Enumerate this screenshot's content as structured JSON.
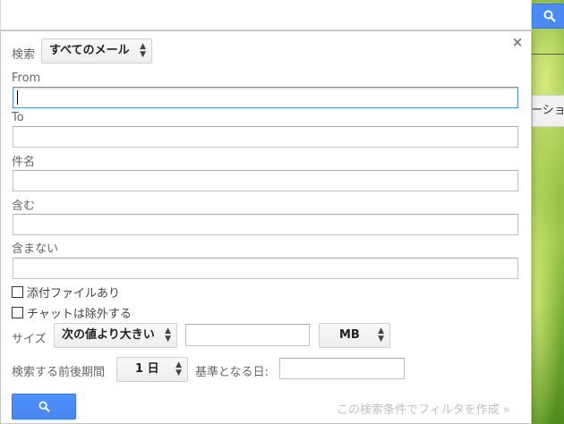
{
  "search_bar": {
    "value": "",
    "button_icon": "search-icon"
  },
  "side_tab": {
    "label": "ーション"
  },
  "panel": {
    "close_label": "×",
    "scope_label": "検索",
    "scope_value": "すべてのメール",
    "from_label": "From",
    "from_value": "",
    "to_label": "To",
    "to_value": "",
    "subject_label": "件名",
    "subject_value": "",
    "has_words_label": "含む",
    "has_words_value": "",
    "doesnt_have_label": "含まない",
    "doesnt_have_value": "",
    "has_attachment_label": "添付ファイルあり",
    "has_attachment_checked": false,
    "exclude_chats_label": "チャットは除外する",
    "exclude_chats_checked": false,
    "size_label": "サイズ",
    "size_operator": "次の値より大きい",
    "size_value": "",
    "size_unit": "MB",
    "date_within_label": "検索する前後期間",
    "date_within_value": "1 日",
    "date_base_label": "基準となる日:",
    "date_base_value": "",
    "search_button_icon": "search-icon",
    "create_filter_label": "この検索条件でフィルタを作成 »"
  },
  "colors": {
    "primary_button": "#4a8af4",
    "focus_border": "#4d90fe",
    "link_muted": "#c0c0c0"
  }
}
